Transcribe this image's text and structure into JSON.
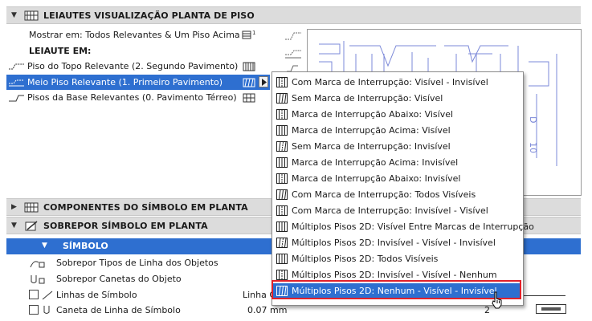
{
  "sections": {
    "floor_plan_layouts": "LEIAUTES VISUALIZAÇÃO PLANTA DE PISO",
    "symbol_components": "COMPONENTES DO SÍMBOLO EM PLANTA",
    "override_symbol": "SOBREPOR SÍMBOLO EM PLANTA",
    "symbol_sub": "SÍMBOLO"
  },
  "layout": {
    "show_on": "Mostrar em: Todos Relevantes & Um Piso Acima",
    "layout_in": "LEIAUTE EM:",
    "rows": [
      {
        "label": "Piso do Topo Relevante (2. Segundo Pavimento)"
      },
      {
        "label": "Meio Piso Relevante (1. Primeiro Pavimento)"
      },
      {
        "label": "Pisos da Base Relevantes (0. Pavimento Térreo)"
      }
    ]
  },
  "override": {
    "rows": [
      {
        "label": "Sobrepor Tipos de Linha dos Objetos",
        "value": ""
      },
      {
        "label": "Sobrepor Canetas do Objeto",
        "value": ""
      },
      {
        "label": "Linhas de Símbolo",
        "value": "Linha C"
      },
      {
        "label": "Caneta de Linha de Símbolo",
        "value": "0.07 mm"
      }
    ],
    "pen_number": "2"
  },
  "preview_labels": {
    "d": "D",
    "ten": "10"
  },
  "menu": {
    "items": [
      "Com Marca de Interrupção: Visível - Invisível",
      "Sem Marca de Interrupção: Visível",
      "Marca de Interrupção Abaixo: Visível",
      "Marca de Interrupção Acima: Visível",
      "Sem Marca de Interrupção: Invisível",
      "Marca de Interrupção Acima: Invisível",
      "Marca de Interrupção Abaixo: Invisível",
      "Com Marca de Interrupção: Todos Visíveis",
      "Com Marca de Interrupção: Invisível - Visível",
      "Múltiplos Pisos 2D: Visível Entre Marcas de Interrupção",
      "Múltiplos Pisos 2D: Invisível - Visível - Invisível",
      "Múltiplos Pisos 2D: Todos Visíveis",
      "Múltiplos Pisos 2D: Invisível - Visível - Nenhum",
      "Múltiplos Pisos 2D: Nenhum - Visível - Invisível"
    ],
    "selected_index": 13
  },
  "colors": {
    "accent": "#2e6fd0",
    "highlight_border": "#e0212b",
    "header_bg": "#dcdcdc",
    "preview_lines": "#7b88d8"
  }
}
